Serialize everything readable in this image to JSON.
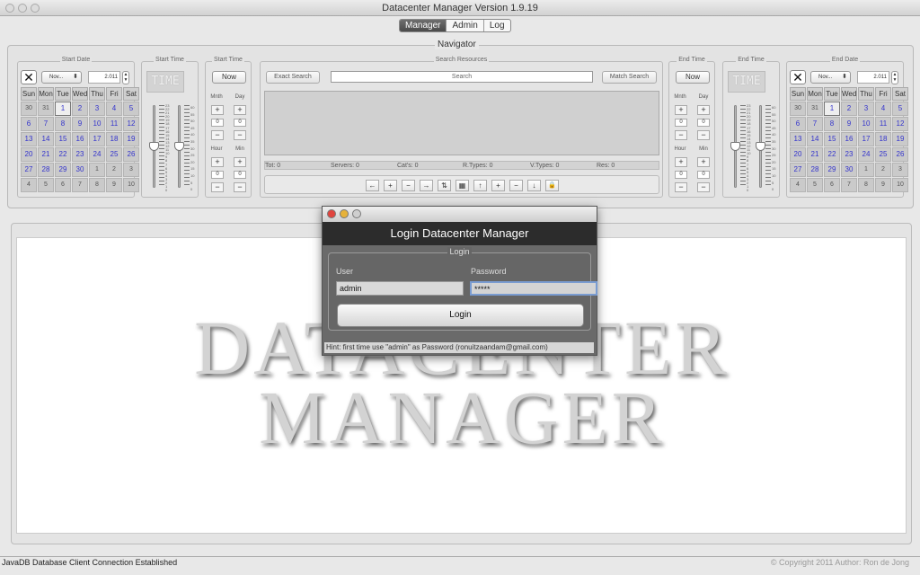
{
  "window": {
    "title": "Datacenter Manager Version 1.9.19"
  },
  "tabs": [
    {
      "label": "Manager",
      "selected": true
    },
    {
      "label": "Admin",
      "selected": false
    },
    {
      "label": "Log",
      "selected": false
    }
  ],
  "navigator": {
    "title": "Navigator",
    "start_date": {
      "label": "Start Date",
      "month": "Nov...",
      "year": "2.011"
    },
    "start_time": {
      "label": "Start Time",
      "display": "TIME"
    },
    "start_time_step": {
      "label": "Start Time",
      "now": "Now",
      "mnth": "Mnth",
      "day": "Day",
      "hour": "Hour",
      "min": "Min",
      "mnth_val": "0",
      "day_val": "0",
      "hour_val": "0",
      "min_val": "0"
    },
    "search": {
      "label": "Search Resources",
      "exact": "Exact Search",
      "placeholder": "Search",
      "match": "Match Search",
      "counts": {
        "tot": "Tot: 0",
        "servers": "Servers: 0",
        "cats": "Cat's: 0",
        "rtypes": "R.Types: 0",
        "vtypes": "V.Types: 0",
        "res": "Res: 0"
      }
    },
    "end_time_step": {
      "label": "End Time",
      "now": "Now",
      "mnth": "Mnth",
      "day": "Day",
      "hour": "Hour",
      "min": "Min",
      "mnth_val": "0",
      "day_val": "0",
      "hour_val": "0",
      "min_val": "0"
    },
    "end_time": {
      "label": "End Time",
      "display": "TIME"
    },
    "end_date": {
      "label": "End Date",
      "month": "Nov...",
      "year": "2.011"
    }
  },
  "calendar": {
    "days": [
      "Sun",
      "Mon",
      "Tue",
      "Wed",
      "Thu",
      "Fri",
      "Sat"
    ],
    "cells": [
      "30",
      "31",
      "1",
      "2",
      "3",
      "4",
      "5",
      "6",
      "7",
      "8",
      "9",
      "10",
      "11",
      "12",
      "13",
      "14",
      "15",
      "16",
      "17",
      "18",
      "19",
      "20",
      "21",
      "22",
      "23",
      "24",
      "25",
      "26",
      "27",
      "28",
      "29",
      "30",
      "1",
      "2",
      "3",
      "4",
      "5",
      "6",
      "7",
      "8",
      "9",
      "10"
    ],
    "selected": "1"
  },
  "slider_ticks": {
    "hour": "23\n22\n21\n20\n19\n18\n17\n16\n15\n14\n13\n12\n11\n10\n9\n8\n7\n6\n5\n4\n3\n2\n1\n0",
    "minute": "60\n55\n50\n45\n40\n35\n30\n25\n20\n15\n10\n5\n0"
  },
  "toolbar": {
    "buttons": [
      "←",
      "+",
      "−",
      "→",
      "⇅",
      "▦",
      "↑",
      "+",
      "−",
      "↓",
      "🔒"
    ]
  },
  "main": {
    "watermark_line1": "DATACENTER",
    "watermark_line2": "MANAGER"
  },
  "status": {
    "left": "JavaDB Database Client Connection Established",
    "right": "© Copyright 2011 Author: Ron de Jong"
  },
  "login_dialog": {
    "title": "Login Datacenter Manager",
    "group": "Login",
    "user_label": "User",
    "user_value": "admin",
    "password_label": "Password",
    "password_value": "*****",
    "login_button": "Login",
    "hint": "Hint: first time use \"admin\" as Password   (ronuitzaandam@gmail.com)"
  },
  "colors": {
    "date_link": "#3333cc",
    "dialog_header": "#2c2c2c",
    "focus_ring": "#7a9cd1"
  }
}
